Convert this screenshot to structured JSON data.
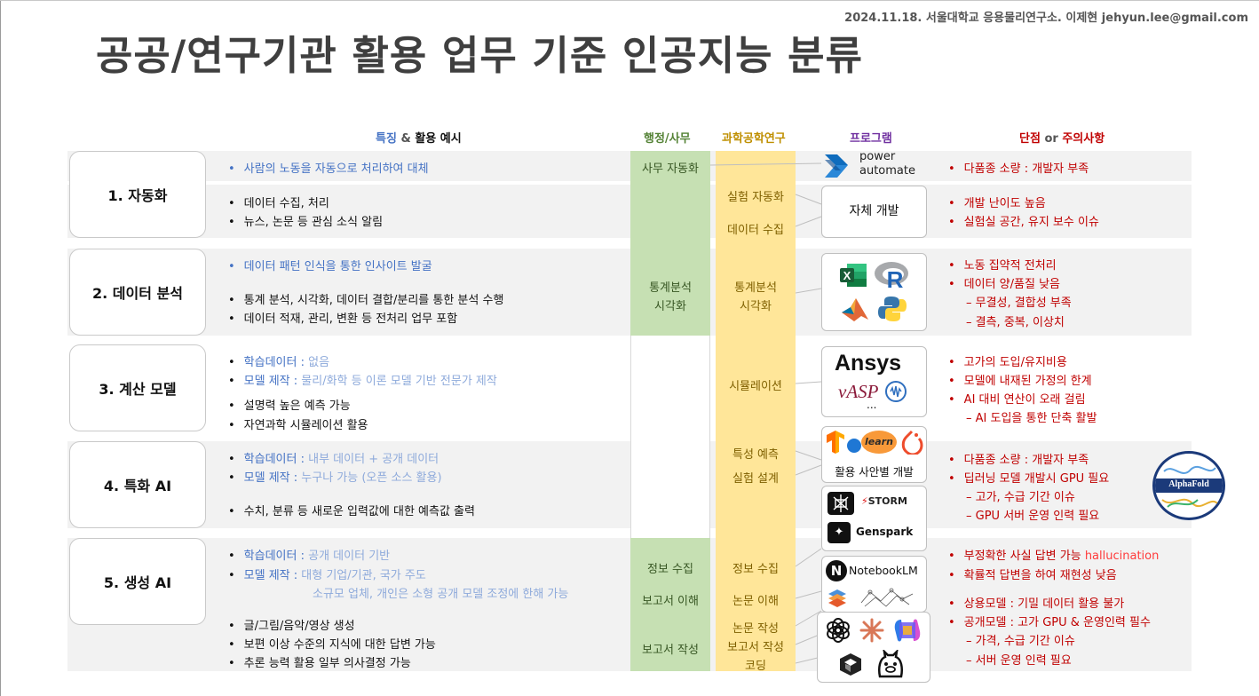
{
  "credit": "2024.11.18. 서울대학교 응용물리연구소. 이제현 jehyun.lee@gmail.com",
  "title": "공공/연구기관 활용 업무 기준 인공지능 분류",
  "headers": {
    "features_a": "특징",
    "features_amp": " & ",
    "features_b": "활용 예시",
    "admin": "행정/사무",
    "science": "과학공학연구",
    "program": "프로그램",
    "cons_a": "단점",
    "cons_or": " or ",
    "cons_b": "주의사항"
  },
  "categories": {
    "c1": "1.  자동화",
    "c2": "2. 데이터 분석",
    "c3": "3. 계산 모델",
    "c4": "4. 특화 AI",
    "c5": "5. 생성 AI"
  },
  "features": {
    "r1_a": "사람의 노동을 자동으로 처리하여 대체",
    "r1_b": "데이터 수집, 처리",
    "r1_c": "뉴스, 논문 등 관심 소식 알림",
    "r2_a": "데이터 패턴 인식을 통한 인사이트 발굴",
    "r2_b": "통계 분석, 시각화, 데이터 결합/분리를 통한 분석 수행",
    "r2_c": "데이터 적재, 관리, 변환 등 전처리 업무 포함",
    "r3_a_k": "학습데이터 : ",
    "r3_a_v": "없음",
    "r3_b_k": "모델 제작 : ",
    "r3_b_v": "물리/화학 등 이론 모델 기반 전문가 제작",
    "r3_c": "설명력 높은 예측 가능",
    "r3_d": "자연과학 시뮬레이션 활용",
    "r4_a_k": "학습데이터 : ",
    "r4_a_v": "내부 데이터 + 공개 데이터",
    "r4_b_k": "모델 제작 : ",
    "r4_b_v": "누구나 가능 (오픈 소스 활용)",
    "r4_c": "수치, 분류 등 새로운 입력값에 대한 예측값 출력",
    "r5_a_k": "학습데이터 : ",
    "r5_a_v": "공개 데이터 기반",
    "r5_b_k": "모델 제작 : ",
    "r5_b_v": "대형 기업/기관, 국가 주도",
    "r5_b2": "소규모 업체, 개인은 소형 공개 모델 조정에 한해 가능",
    "r5_c": "글/그림/음악/영상 생성",
    "r5_d": "보편 이상 수준의 지식에 대한 답변 가능",
    "r5_e": "추론 능력 활용 일부 의사결정 가능"
  },
  "admin": {
    "a1": "사무 자동화",
    "a2a": "통계분석",
    "a2b": "시각화",
    "a5a": "정보 수집",
    "a5b": "보고서 이해",
    "a5c": "보고서 작성"
  },
  "science": {
    "s1a": "실험 자동화",
    "s1b": "데이터 수집",
    "s2a": "통계분석",
    "s2b": "시각화",
    "s3": "시뮬레이션",
    "s4a": "특성 예측",
    "s4b": "실험 설계",
    "s5a": "정보 수집",
    "s5b": "논문 이해",
    "s5c": "논문 작성",
    "s5d": "보고서 작성",
    "s5e": "코딩"
  },
  "programs": {
    "pa_1": "power",
    "pa_2": "automate",
    "self_dev": "자체 개발",
    "excel": "X",
    "r": "R",
    "ansys": "Ansys",
    "vasp": "vASP",
    "ellipsis": "...",
    "learn": "learn",
    "case_dev": "활용 사안별 개발",
    "storm": "STORM",
    "genspark": "Genspark",
    "nblm_n": "N",
    "nblm": "NotebookLM",
    "alphafold": "AlphaFold"
  },
  "cons": {
    "r1_a": "다품종 소량 : 개발자 부족",
    "r1_b": "개발 난이도 높음",
    "r1_c": "실험실 공간, 유지 보수 이슈",
    "r2_a": "노동 집약적 전처리",
    "r2_b": "데이터 양/품질 낮음",
    "r2_c": "– 무결성, 결합성 부족",
    "r2_d": "– 결측, 중복, 이상치",
    "r3_a": "고가의 도입/유지비용",
    "r3_b": "모델에 내재된 가정의 한계",
    "r3_c": "AI 대비 연산이 오래 걸림",
    "r3_d": "– AI 도입을 통한 단축 활발",
    "r4_a": "다품종 소량 : 개발자 부족",
    "r4_b": "딥러닝 모델 개발시 GPU 필요",
    "r4_c": "– 고가, 수급 기간 이슈",
    "r4_d": "– GPU 서버 운영 인력 필요",
    "r5_a": "부정확한 사실 답변 가능 ",
    "r5_a_en": "hallucination",
    "r5_b": "확률적 답변을 하여 재현성 낮음",
    "r5_c": "상용모델 : 기밀 데이터 활용 불가",
    "r5_d": "공개모델 : 고가 GPU & 운영인력 필수",
    "r5_e": "– 가격, 수급 기간 이슈",
    "r5_f": "– 서버 운영 인력 필요"
  },
  "colors": {
    "blue": "#4472c4",
    "light_blue": "#8eaadb",
    "red": "#c00000",
    "green_col": "#c6e0b3",
    "yellow_col": "#ffe699",
    "band": "#f2f2f2"
  }
}
